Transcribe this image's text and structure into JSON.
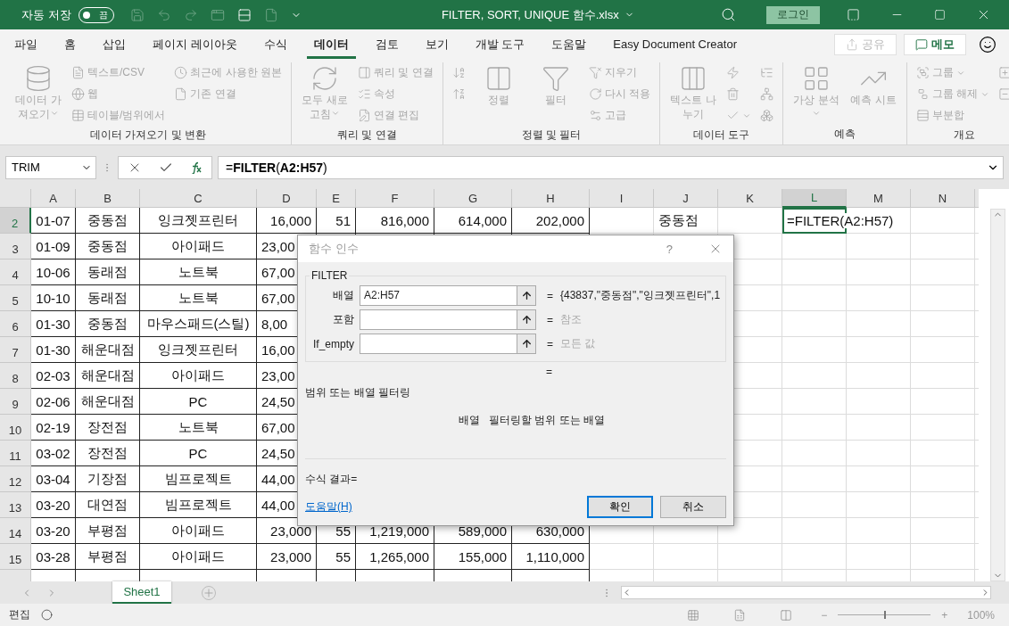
{
  "title_bar": {
    "autosave_label": "자동 저장",
    "autosave": {
      "on": false,
      "label": "끔"
    },
    "title": "FILTER, SORT, UNIQUE 함수.xlsx",
    "login": "로그인"
  },
  "menu": {
    "tabs": [
      {
        "label": "파일",
        "selected": false
      },
      {
        "label": "홈",
        "selected": false
      },
      {
        "label": "삽입",
        "selected": false
      },
      {
        "label": "페이지 레이아웃",
        "selected": false
      },
      {
        "label": "수식",
        "selected": false
      },
      {
        "label": "데이터",
        "selected": true
      },
      {
        "label": "검토",
        "selected": false
      },
      {
        "label": "보기",
        "selected": false
      },
      {
        "label": "개발 도구",
        "selected": false
      },
      {
        "label": "도움말",
        "selected": false
      },
      {
        "label": "Easy Document Creator",
        "selected": false
      }
    ],
    "share": {
      "label": "공유",
      "disabled": true
    },
    "memo": {
      "label": "메모",
      "disabled": false
    }
  },
  "ribbon": {
    "disabled": true,
    "groups": [
      {
        "label": "데이터 가져오기 및 변환",
        "items": [
          {
            "kind": "large",
            "label": "데이터 가져오기",
            "dropdown": true
          },
          {
            "kind": "small",
            "label": "텍스트/CSV"
          },
          {
            "kind": "small",
            "label": "웹"
          },
          {
            "kind": "small",
            "label": "테이블/범위에서"
          },
          {
            "kind": "small",
            "label": "최근에 사용한 원본"
          },
          {
            "kind": "small",
            "label": "기존 연결"
          }
        ]
      },
      {
        "label": "쿼리 및 연결",
        "items": [
          {
            "kind": "large",
            "label": "모두 새로 고침",
            "dropdown": true
          },
          {
            "kind": "small",
            "label": "쿼리 및 연결"
          },
          {
            "kind": "small",
            "label": "속성"
          },
          {
            "kind": "small",
            "label": "연결 편집"
          }
        ]
      },
      {
        "label": "정렬 및 필터",
        "items": [
          {
            "kind": "icon"
          },
          {
            "kind": "icon"
          },
          {
            "kind": "large",
            "label": "정렬"
          },
          {
            "kind": "large",
            "label": "필터"
          },
          {
            "kind": "small",
            "label": "지우기"
          },
          {
            "kind": "small",
            "label": "다시 적용"
          },
          {
            "kind": "small",
            "label": "고급"
          }
        ]
      },
      {
        "label": "데이터 도구",
        "items": [
          {
            "kind": "large",
            "label": "텍스트 나누기"
          },
          {
            "kind": "icon"
          },
          {
            "kind": "icon"
          },
          {
            "kind": "icon",
            "dropdown": true
          },
          {
            "kind": "icon"
          },
          {
            "kind": "icon"
          },
          {
            "kind": "icon"
          }
        ]
      },
      {
        "label": "예측",
        "items": [
          {
            "kind": "large",
            "label": "가상 분석",
            "dropdown": true
          },
          {
            "kind": "large",
            "label": "예측 시트"
          }
        ]
      },
      {
        "label": "개요",
        "items": [
          {
            "kind": "small",
            "label": "그룹",
            "dropdown": true
          },
          {
            "kind": "small",
            "label": "그룹 해제",
            "dropdown": true
          },
          {
            "kind": "small",
            "label": "부분합"
          },
          {
            "kind": "icon"
          },
          {
            "kind": "icon"
          }
        ]
      }
    ]
  },
  "formula_bar": {
    "name_box": "TRIM",
    "formula": "=**FILTER**(**A2:H57**)"
  },
  "sheet": {
    "columns": [
      {
        "name": "A",
        "selected": false
      },
      {
        "name": "B",
        "selected": false
      },
      {
        "name": "C",
        "selected": false
      },
      {
        "name": "D",
        "selected": false
      },
      {
        "name": "E",
        "selected": false
      },
      {
        "name": "F",
        "selected": false
      },
      {
        "name": "G",
        "selected": false
      },
      {
        "name": "H",
        "selected": false
      },
      {
        "name": "I",
        "selected": false
      },
      {
        "name": "J",
        "selected": false
      },
      {
        "name": "K",
        "selected": false
      },
      {
        "name": "L",
        "selected": true
      },
      {
        "name": "M",
        "selected": false
      },
      {
        "name": "N",
        "selected": false
      }
    ],
    "rows": [
      {
        "header": "2",
        "selected": true,
        "cells": [
          "01-07",
          "중동점",
          "잉크젯프린터",
          "16,000",
          "51",
          "816,000",
          "614,000",
          "202,000",
          null,
          "중동점",
          null,
          "=FILTER(A2:H57)"
        ]
      },
      {
        "header": "3",
        "selected": false,
        "under_dialog": true,
        "cells": [
          "01-09",
          "중동점",
          "아이패드",
          "23,00"
        ]
      },
      {
        "header": "4",
        "selected": false,
        "under_dialog": true,
        "cells": [
          "10-06",
          "동래점",
          "노트북",
          "67,00"
        ]
      },
      {
        "header": "5",
        "selected": false,
        "under_dialog": true,
        "cells": [
          "10-10",
          "동래점",
          "노트북",
          "67,00"
        ]
      },
      {
        "header": "6",
        "selected": false,
        "under_dialog": true,
        "cells": [
          "01-30",
          "중동점",
          "마우스패드(스틸)",
          "8,00"
        ]
      },
      {
        "header": "7",
        "selected": false,
        "under_dialog": true,
        "cells": [
          "01-30",
          "해운대점",
          "잉크젯프린터",
          "16,00"
        ]
      },
      {
        "header": "8",
        "selected": false,
        "under_dialog": true,
        "cells": [
          "02-03",
          "해운대점",
          "아이패드",
          "23,00"
        ]
      },
      {
        "header": "9",
        "selected": false,
        "under_dialog": true,
        "cells": [
          "02-06",
          "해운대점",
          "PC",
          "24,50"
        ]
      },
      {
        "header": "10",
        "selected": false,
        "under_dialog": true,
        "cells": [
          "02-19",
          "장전점",
          "노트북",
          "67,00"
        ]
      },
      {
        "header": "11",
        "selected": false,
        "under_dialog": true,
        "cells": [
          "03-02",
          "장전점",
          "PC",
          "24,50"
        ]
      },
      {
        "header": "12",
        "selected": false,
        "under_dialog": true,
        "cells": [
          "03-04",
          "기장점",
          "빔프로젝트",
          "44,00"
        ]
      },
      {
        "header": "13",
        "selected": false,
        "under_dialog": true,
        "cells": [
          "03-20",
          "대연점",
          "빔프로젝트",
          "44,00"
        ]
      },
      {
        "header": "14",
        "selected": false,
        "under_dialog": false,
        "cells": [
          "03-20",
          "부평점",
          "아이패드",
          "23,000",
          "55",
          "1,219,000",
          "589,000",
          "630,000"
        ]
      },
      {
        "header": "15",
        "selected": false,
        "under_dialog": false,
        "cells": [
          "03-28",
          "부평점",
          "아이패드",
          "23,000",
          "55",
          "1,265,000",
          "155,000",
          "1,110,000"
        ]
      }
    ]
  },
  "dialog": {
    "title": "함수 인수",
    "help": "?",
    "function": "FILTER",
    "args": [
      {
        "label": "배열",
        "value": "A2:H57",
        "eq": "=",
        "result": "{43837,\"중동점\",\"잉크젯프린터\",1",
        "hint": false
      },
      {
        "label": "포함",
        "eq": "=",
        "result": "참조",
        "hint": true
      },
      {
        "label": "If_empty",
        "eq": "=",
        "result": "모든 값",
        "hint": true
      }
    ],
    "total_eq": "=",
    "description": "범위 또는 배열 필터링",
    "arg_name": "배열",
    "arg_description": "필터링할 범위 또는 배열",
    "formula_result": "수식 결과=",
    "help_link": "도움말(H)",
    "buttons": [
      {
        "label": "확인",
        "default": true
      },
      {
        "label": "취소",
        "default": false
      }
    ]
  },
  "sheet_tabs": [
    {
      "label": "Sheet1",
      "selected": true
    }
  ],
  "status_bar": {
    "mode": "편집",
    "zoom_minus": "−",
    "zoom_plus": "+",
    "zoom": {
      "level": 0.5
    },
    "zoom_label": "100%"
  }
}
